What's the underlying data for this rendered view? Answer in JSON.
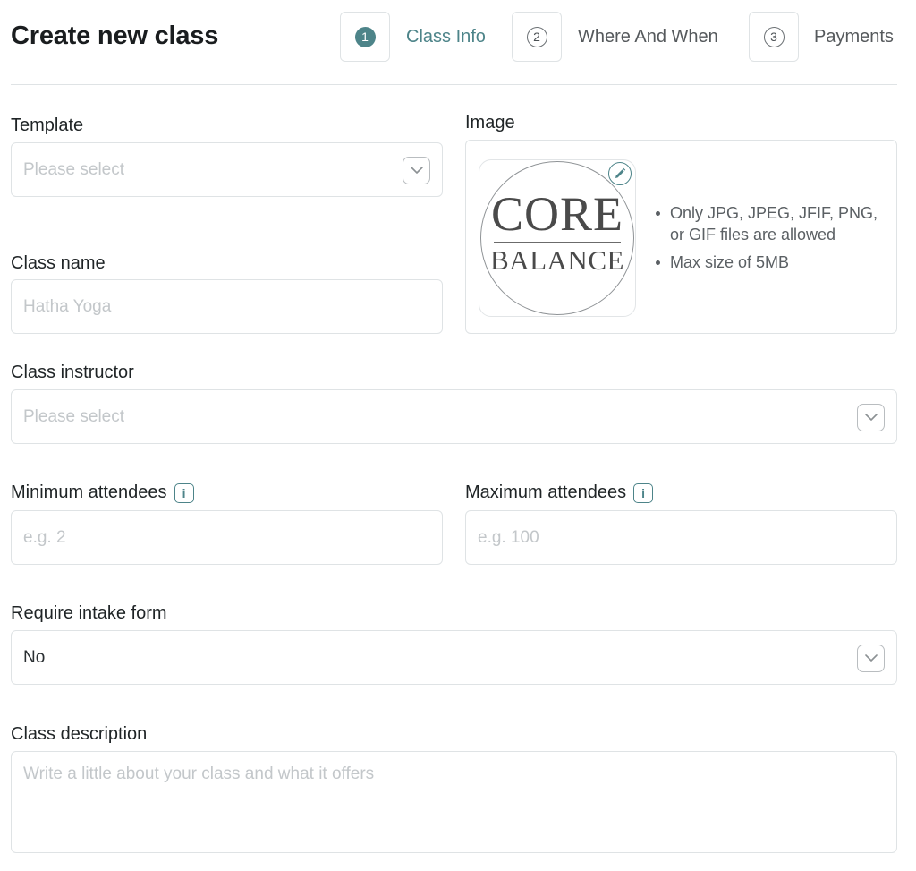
{
  "header": {
    "title": "Create new class"
  },
  "steps": [
    {
      "number": "1",
      "label": "Class Info",
      "state": "active"
    },
    {
      "number": "2",
      "label": "Where And When",
      "state": "inactive"
    },
    {
      "number": "3",
      "label": "Payments",
      "state": "inactive"
    }
  ],
  "form": {
    "template": {
      "label": "Template",
      "placeholder": "Please select"
    },
    "class_name": {
      "label": "Class name",
      "placeholder": "Hatha Yoga"
    },
    "image": {
      "label": "Image",
      "logo_line1": "CORE",
      "logo_line2": "BALANCE",
      "rules": [
        "Only JPG, JPEG, JFIF, PNG, or GIF files are allowed",
        "Max size of 5MB"
      ]
    },
    "instructor": {
      "label": "Class instructor",
      "placeholder": "Please select"
    },
    "min_attendees": {
      "label": "Minimum attendees",
      "placeholder": "e.g. 2"
    },
    "max_attendees": {
      "label": "Maximum attendees",
      "placeholder": "e.g. 100"
    },
    "intake_form": {
      "label": "Require intake form",
      "value": "No"
    },
    "description": {
      "label": "Class description",
      "placeholder": "Write a little about your class and what it offers"
    }
  },
  "icons": {
    "chevron": "chevron-down-icon",
    "info": "info-icon",
    "edit": "pencil-icon"
  },
  "colors": {
    "accent": "#4d8489",
    "border": "#dfe3e5",
    "placeholder": "#c3c7ca"
  }
}
